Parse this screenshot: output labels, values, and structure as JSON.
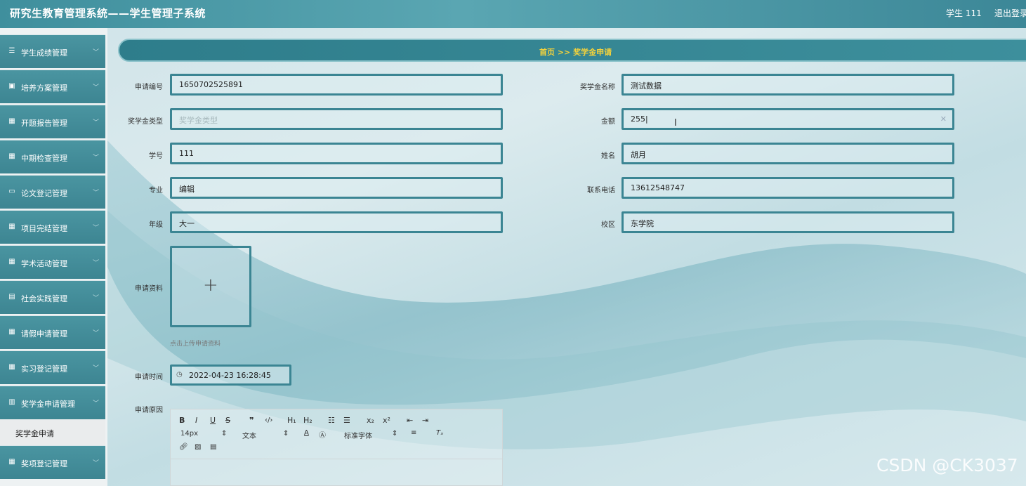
{
  "app": {
    "title": "研究生教育管理系统——学生管理子系统",
    "user": "学生 111",
    "logout": "退出登录"
  },
  "sidebar": {
    "items": [
      {
        "label": "学生成绩管理",
        "icon": "list-icon"
      },
      {
        "label": "培养方案管理",
        "icon": "doc-icon"
      },
      {
        "label": "开题报告管理",
        "icon": "grid-icon"
      },
      {
        "label": "中期检查管理",
        "icon": "grid-icon"
      },
      {
        "label": "论文登记管理",
        "icon": "monitor-icon"
      },
      {
        "label": "项目完结管理",
        "icon": "grid-icon"
      },
      {
        "label": "学术活动管理",
        "icon": "grid-icon"
      },
      {
        "label": "社会实践管理",
        "icon": "clipboard-icon"
      },
      {
        "label": "请假申请管理",
        "icon": "grid-icon"
      },
      {
        "label": "实习登记管理",
        "icon": "grid-icon"
      },
      {
        "label": "奖学金申请管理",
        "icon": "chart-icon"
      },
      {
        "label": "奖项登记管理",
        "icon": "grid-icon"
      }
    ],
    "active_sub": "奖学金申请"
  },
  "breadcrumb": {
    "text": "首页 >> 奖学金申请"
  },
  "form": {
    "apply_no": {
      "label": "申请编号",
      "value": "1650702525891"
    },
    "name": {
      "label": "奖学金名称",
      "value": "测试数据"
    },
    "type": {
      "label": "奖学金类型",
      "placeholder": "奖学金类型"
    },
    "amount": {
      "label": "金额",
      "value": "255"
    },
    "student_id": {
      "label": "学号",
      "value": "111"
    },
    "student_name": {
      "label": "姓名",
      "value": "胡月"
    },
    "major": {
      "label": "专业",
      "value": "编辑"
    },
    "phone": {
      "label": "联系电话",
      "value": "13612548747"
    },
    "grade": {
      "label": "年级",
      "value": "大一"
    },
    "campus": {
      "label": "校区",
      "value": "东学院"
    },
    "materials": {
      "label": "申请资料",
      "hint": "点击上传申请资料"
    },
    "apply_time": {
      "label": "申请时间",
      "value": "2022-04-23 16:28:45"
    },
    "reason": {
      "label": "申请原因"
    }
  },
  "editor": {
    "font_size": "14px",
    "block_type": "文本",
    "font_family": "标准字体"
  },
  "watermark": "CSDN @CK3037",
  "colors": {
    "accent": "#3b8593",
    "breadcrumb_text": "#f4d23c"
  }
}
